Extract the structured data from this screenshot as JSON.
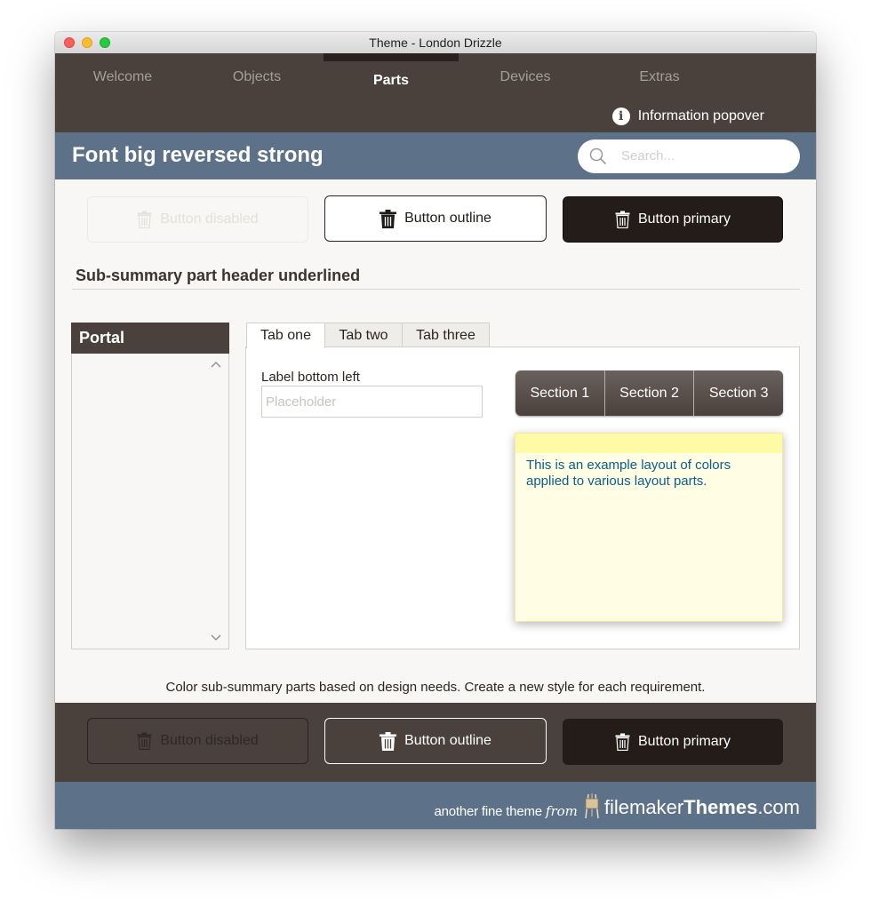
{
  "window": {
    "title": "Theme - London Drizzle"
  },
  "nav": {
    "items": [
      {
        "label": "Welcome"
      },
      {
        "label": "Objects"
      },
      {
        "label": "Parts"
      },
      {
        "label": "Devices"
      },
      {
        "label": "Extras"
      }
    ],
    "active": "Parts",
    "info_popover_label": "Information popover"
  },
  "band": {
    "title": "Font big reversed strong",
    "search_placeholder": "Search..."
  },
  "buttons_top": {
    "disabled_label": "Button disabled",
    "outline_label": "Button outline",
    "primary_label": "Button primary"
  },
  "sub_summary_header": "Sub-summary part header underlined",
  "portal": {
    "title": "Portal"
  },
  "tabs": [
    {
      "label": "Tab one"
    },
    {
      "label": "Tab two"
    },
    {
      "label": "Tab three"
    }
  ],
  "active_tab": "Tab one",
  "field": {
    "label": "Label bottom left",
    "placeholder": "Placeholder"
  },
  "sections": [
    {
      "label": "Section 1"
    },
    {
      "label": "Section 2"
    },
    {
      "label": "Section 3"
    }
  ],
  "note": {
    "text": "This is an example layout of colors applied to various layout parts."
  },
  "caption": "Color sub-summary parts based on design needs. Create a new style for each requirement.",
  "buttons_bottom": {
    "disabled_label": "Button disabled",
    "outline_label": "Button outline",
    "primary_label": "Button primary"
  },
  "brand": {
    "prefix": "another fine theme",
    "from": "from",
    "name_light": "filemaker",
    "name_bold": "Themes",
    "suffix": ".com"
  },
  "colors": {
    "header_brown": "#4b413c",
    "band_blue": "#5d7189",
    "primary_button": "#231c19",
    "note_text": "#0b5f8c",
    "note_bg": "#fffde3"
  },
  "icons": [
    "info-icon",
    "search-icon",
    "trash-icon",
    "chevron-up-icon",
    "chevron-down-icon",
    "easel-logo-icon"
  ]
}
